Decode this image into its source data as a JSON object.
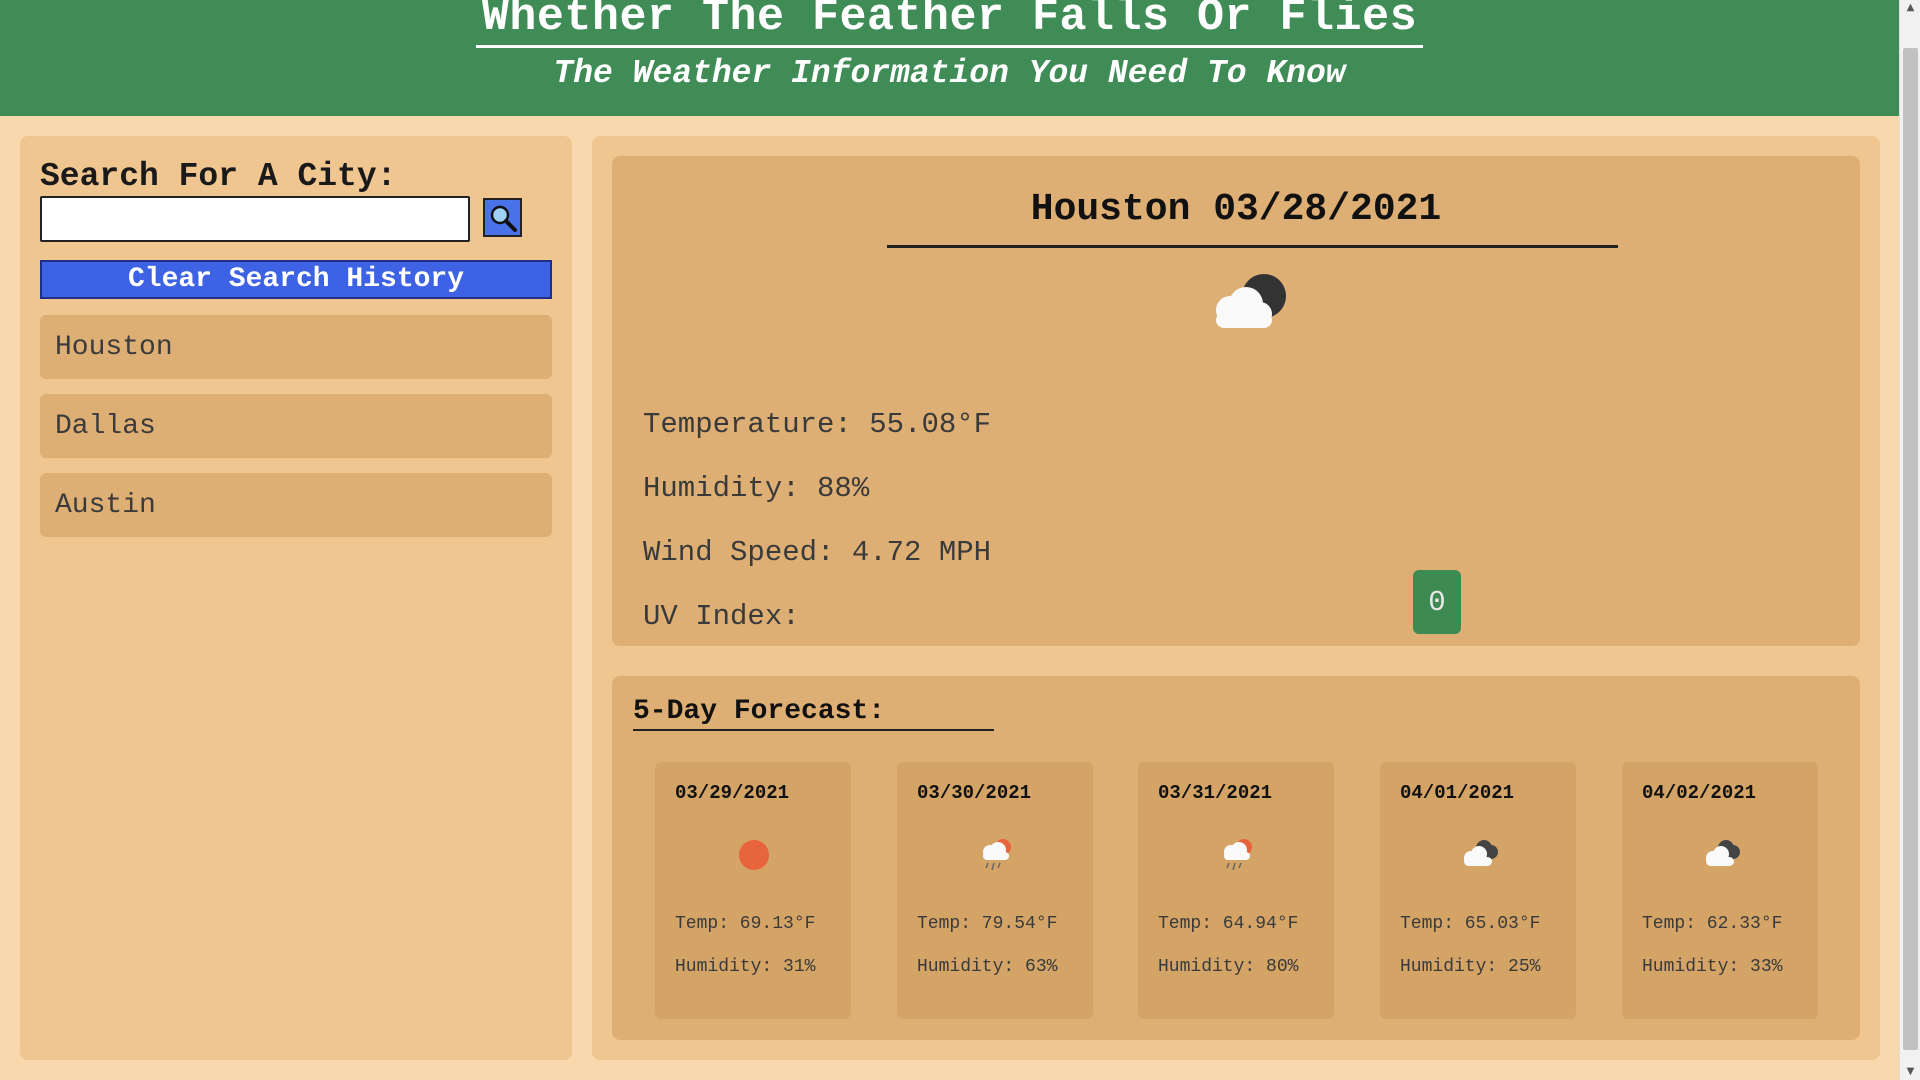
{
  "header": {
    "title": "Whether The Feather Falls Or Flies",
    "subtitle": "The Weather Information You Need To Know"
  },
  "sidebar": {
    "search_label": "Search For A City:",
    "search_value": "",
    "search_icon": "search-icon",
    "clear_label": "Clear Search History",
    "history": [
      "Houston",
      "Dallas",
      "Austin"
    ]
  },
  "current": {
    "title": "Houston 03/28/2021",
    "icon": "cloud-night-icon",
    "temperature": "Temperature: 55.08°F",
    "humidity": "Humidity: 88%",
    "wind": "Wind Speed: 4.72 MPH",
    "uv_label": "UV Index:",
    "uv_value": "0"
  },
  "forecast": {
    "title": "5-Day Forecast:",
    "days": [
      {
        "date": "03/29/2021",
        "icon": "sun-icon",
        "temp": "Temp: 69.13°F",
        "humidity": "Humidity: 31%"
      },
      {
        "date": "03/30/2021",
        "icon": "rain-sun-icon",
        "temp": "Temp: 79.54°F",
        "humidity": "Humidity: 63%"
      },
      {
        "date": "03/31/2021",
        "icon": "rain-sun-icon",
        "temp": "Temp: 64.94°F",
        "humidity": "Humidity: 80%"
      },
      {
        "date": "04/01/2021",
        "icon": "broken-clouds-icon",
        "temp": "Temp: 65.03°F",
        "humidity": "Humidity: 25%"
      },
      {
        "date": "04/02/2021",
        "icon": "broken-clouds-icon",
        "temp": "Temp: 62.33°F",
        "humidity": "Humidity: 33%"
      }
    ]
  },
  "colors": {
    "header_bg": "#408c56",
    "page_bg": "#f9d8ad",
    "panel_bg": "#efc590",
    "card_bg": "#deaf74",
    "button_blue": "#3d63e4",
    "uv_green": "#3d8a52"
  }
}
